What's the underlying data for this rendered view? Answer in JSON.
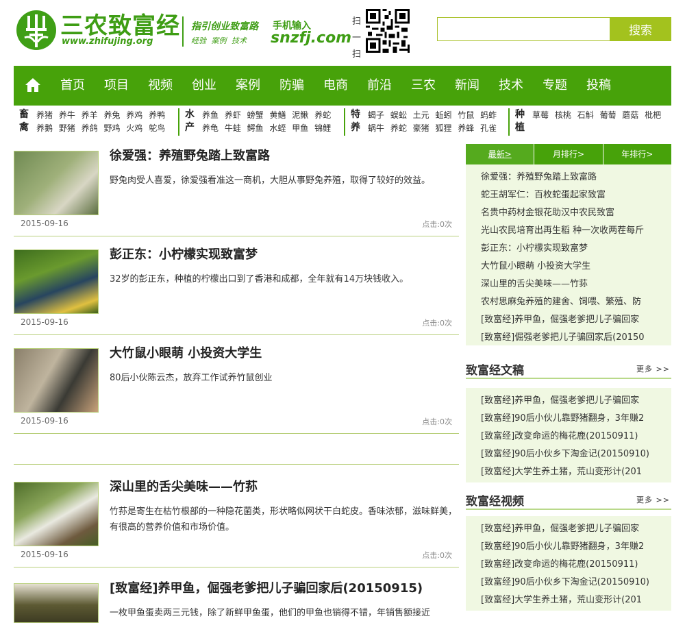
{
  "header": {
    "logo_text": "三农致富经",
    "logo_url": "www.zhifujing.org",
    "slogan": "指引创业致富路",
    "slogan_tags": "经验 案例 技术",
    "mobile_label": "手机输入",
    "mobile_domain": "snzfj.com",
    "scan_label": "扫一扫",
    "search_placeholder": "",
    "search_button": "搜索"
  },
  "nav": {
    "items": [
      "首页",
      "项目",
      "视频",
      "创业",
      "案例",
      "防骗",
      "电商",
      "前沿",
      "三农",
      "新闻",
      "技术",
      "专题",
      "投稿"
    ]
  },
  "categories": [
    {
      "title": "畜禽",
      "row1": "养猪 养牛 养羊 养兔 养鸡 养鸭",
      "row2": "养鹅 野猪 养鸽 野鸡 火鸡 鸵鸟"
    },
    {
      "title": "水产",
      "row1": "养鱼 养虾 螃蟹 黄鳝 泥鳅 养蛇",
      "row2": "养龟 牛蛙 鳄鱼 水蛭 甲鱼 锦鲤"
    },
    {
      "title": "特养",
      "row1": "蝎子 蜈蚣 土元 蚯蚓 竹鼠 蚂蚱",
      "row2": "蜗牛 养蛇 豪猪 狐狸 养蜂 孔雀"
    },
    {
      "title": "种植",
      "row1": "草莓 核桃 石斛 葡萄 蘑菇 枇杷",
      "row2": ""
    }
  ],
  "articles": [
    {
      "title": "徐爱强：养殖野兔踏上致富路",
      "summary": "野兔肉受人喜爱，徐爱强看准这一商机，大胆从事野兔养殖，取得了较好的效益。",
      "date": "2015-09-16",
      "views": "点击:0次"
    },
    {
      "title": "彭正东：小柠檬实现致富梦",
      "summary": "32岁的彭正东，种植的柠檬出口到了香港和成都，全年就有14万块钱收入。",
      "date": "2015-09-16",
      "views": "点击:0次"
    },
    {
      "title": "大竹鼠小眼萌 小投资大学生",
      "summary": "80后小伙陈云杰，放弃工作试养竹鼠创业",
      "date": "2015-09-16",
      "views": "点击:0次"
    },
    {
      "title": "深山里的舌尖美味——竹荪",
      "summary": "竹荪是寄生在枯竹根部的一种隐花菌类，形状略似网状干白蛇皮。香味浓郁，滋味鲜美，有很高的营养价值和市场价值。",
      "date": "2015-09-16",
      "views": "点击:0次"
    },
    {
      "title": "[致富经]养甲鱼，倔强老爹把儿子骗回家后(20150915)",
      "summary": "一枚甲鱼蛋卖两三元钱，除了新鲜甲鱼蛋，他们的甲鱼也销得不错，年销售额接近",
      "date": "",
      "views": ""
    }
  ],
  "sidebar": {
    "tabs": [
      "最新>",
      "月排行>",
      "年排行>"
    ],
    "latest": [
      "徐爱强：养殖野兔踏上致富路",
      "蛇王胡军仁：百枚蛇蛋起家致富",
      "名贵中药材金银花助汉中农民致富",
      "光山农民培育出再生稻 种一次收两茬每斤",
      "彭正东：小柠檬实现致富梦",
      "大竹鼠小眼萌 小投资大学生",
      "深山里的舌尖美味——竹荪",
      "农村思麻兔养殖的建舍、饲喂、繁殖、防",
      "[致富经]养甲鱼，倔强老爹把儿子骗回家",
      "[致富经]倔强老爹把儿子骗回家后(20150"
    ],
    "articles_heading": "致富经文稿",
    "articles_more": "更多 >>",
    "articles": [
      "[致富经]养甲鱼，倔强老爹把儿子骗回家",
      "[致富经]90后小伙儿靠野猪翻身，3年赚2",
      "[致富经]改变命运的梅花鹿(20150911)",
      "[致富经]90后小伙乡下淘金记(20150910)",
      "[致富经]大学生养土猪，荒山变形计(201"
    ],
    "videos_heading": "致富经视频",
    "videos_more": "更多 >>",
    "videos": [
      "[致富经]养甲鱼，倔强老爹把儿子骗回家",
      "[致富经]90后小伙儿靠野猪翻身，3年赚2",
      "[致富经]改变命运的梅花鹿(20150911)",
      "[致富经]90后小伙乡下淘金记(20150910)",
      "[致富经]大学生养土猪，荒山变形计(201"
    ]
  },
  "colors": {
    "brand_green": "#47a20a",
    "search_green": "#a3c21e",
    "side_bg": "#f0f8e2"
  },
  "icons": {
    "home": "home-icon",
    "logo": "wheat-logo-icon",
    "qr": "qr-code-icon"
  }
}
